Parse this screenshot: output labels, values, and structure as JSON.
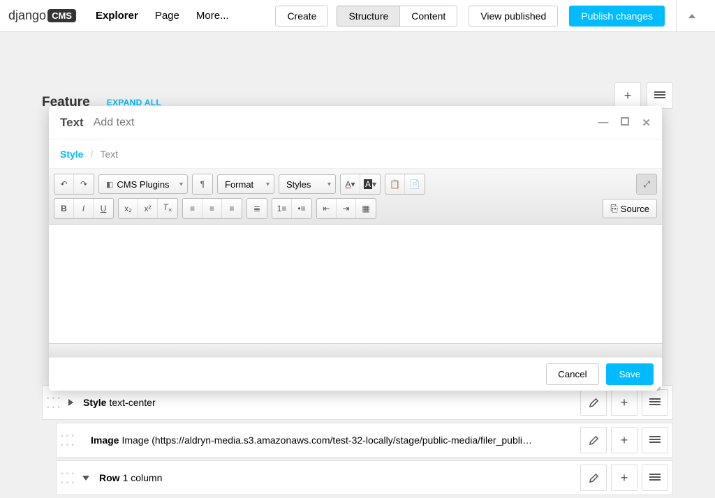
{
  "toolbar": {
    "logo_left": "django",
    "logo_right": "CMS",
    "nav": {
      "explorer": "Explorer",
      "page": "Page",
      "more": "More..."
    },
    "create": "Create",
    "structure": "Structure",
    "content": "Content",
    "view_published": "View published",
    "publish": "Publish changes"
  },
  "placeholder": {
    "title": "Feature",
    "expand_all": "EXPAND ALL"
  },
  "modal": {
    "title": "Text",
    "subtitle": "Add text",
    "breadcrumb": {
      "active": "Style",
      "item": "Text"
    },
    "cancel": "Cancel",
    "save": "Save"
  },
  "editor": {
    "cms_plugins": "CMS Plugins",
    "format": "Format",
    "styles": "Styles",
    "source": "Source"
  },
  "plugins": {
    "style": {
      "name": "Style",
      "desc": "text-center"
    },
    "image": {
      "name": "Image",
      "desc": "Image (https://aldryn-media.s3.amazonaws.com/test-32-locally/stage/public-media/filer_publi…"
    },
    "row": {
      "name": "Row",
      "desc": "1 column"
    }
  }
}
